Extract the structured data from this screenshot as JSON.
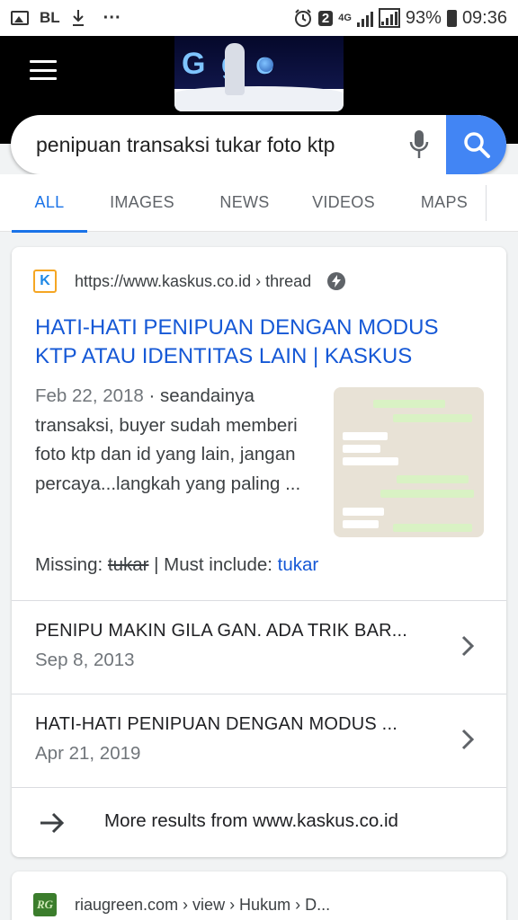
{
  "status_bar": {
    "bl": "BL",
    "ellipsis": "···",
    "sim": "2",
    "network": "4G",
    "battery_pct": "93%",
    "time": "09:36"
  },
  "header": {
    "doodle_text": "G   g o"
  },
  "search": {
    "query": "penipuan transaksi tukar foto ktp"
  },
  "tabs": [
    {
      "label": "ALL",
      "active": true
    },
    {
      "label": "IMAGES"
    },
    {
      "label": "NEWS"
    },
    {
      "label": "VIDEOS"
    },
    {
      "label": "MAPS"
    }
  ],
  "result1": {
    "url": "https://www.kaskus.co.id › thread",
    "title": "HATI-HATI PENIPUAN DENGAN MODUS KTP ATAU IDENTITAS LAIN | KASKUS",
    "date": "Feb 22, 2018",
    "snippet": " · seandainya transaksi, buyer sudah memberi foto ktp dan id yang lain, jangan percaya...langkah yang paling ...",
    "missing_label": "Missing: ",
    "missing_term": "tukar",
    "must_include_label": " | Must include: ",
    "must_include_term": "tukar",
    "sub_results": [
      {
        "title": "PENIPU MAKIN GILA GAN. ADA TRIK BAR...",
        "date": "Sep 8, 2013"
      },
      {
        "title": "HATI-HATI PENIPUAN DENGAN MODUS ...",
        "date": "Apr 21, 2019"
      }
    ],
    "more_results": "More results from www.kaskus.co.id"
  },
  "result2": {
    "url": "riaugreen.com › view › Hukum › D...",
    "favicon_text": "RG"
  },
  "colors": {
    "accent": "#1a73e8",
    "link": "#1558d6",
    "search_button": "#4285f4"
  },
  "icons": [
    "image-icon",
    "download-icon",
    "alarm-icon",
    "signal-icon",
    "battery-icon",
    "menu-icon",
    "mic-icon",
    "search-icon",
    "amp-icon",
    "chevron-right-icon",
    "arrow-right-icon"
  ]
}
